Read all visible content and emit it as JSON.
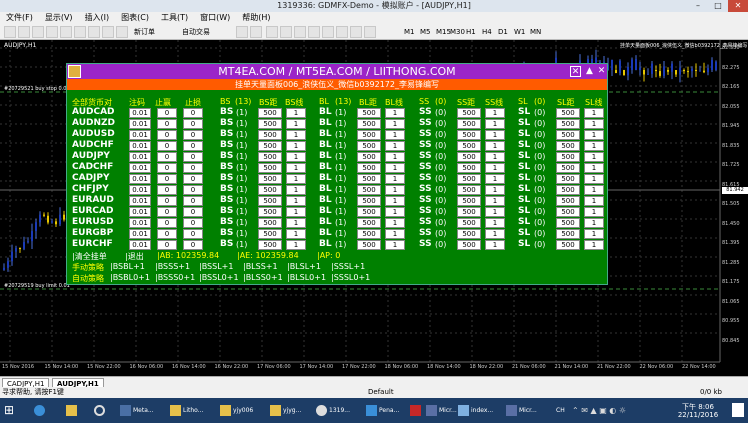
{
  "window": {
    "title": "1319336: GDMFX-Demo - 模拟账户 - [AUDJPY,H1]"
  },
  "menu": [
    "文件(F)",
    "显示(V)",
    "插入(I)",
    "图表(C)",
    "工具(T)",
    "窗口(W)",
    "帮助(H)"
  ],
  "toolbar": {
    "new_order": "新订单",
    "auto_trade": "自动交易",
    "timeframes": [
      "M1",
      "M5",
      "M15",
      "M30",
      "H1",
      "H4",
      "D1",
      "W1",
      "MN"
    ]
  },
  "chart": {
    "symbol_label": "AUDJPY,H1",
    "right_label": "挂单天量面板006_浪侠伍义_微信b0392172_李易锋编写",
    "line_label_1": "#20729521 buy stop 0.01",
    "line_label_2": "#20729519 buy limit 0.01",
    "price_labels": [
      "82.330",
      "82.275",
      "82.165",
      "82.055",
      "81.945",
      "81.835",
      "81.725",
      "81.615",
      "81.505",
      "81.450",
      "81.395",
      "81.285",
      "81.175",
      "81.065",
      "80.955",
      "80.845"
    ],
    "current_price": "81.942",
    "time_labels": [
      "15 Nov 2016",
      "15 Nov 14:00",
      "15 Nov 22:00",
      "16 Nov 06:00",
      "16 Nov 14:00",
      "16 Nov 22:00",
      "17 Nov 06:00",
      "17 Nov 14:00",
      "17 Nov 22:00",
      "18 Nov 06:00",
      "18 Nov 14:00",
      "18 Nov 22:00",
      "21 Nov 06:00",
      "21 Nov 14:00",
      "21 Nov 22:00",
      "22 Nov 06:00",
      "22 Nov 14:00"
    ]
  },
  "panel": {
    "title": "MT4EA.COM / MT5EA.COM / LIITHONG.COM",
    "subtitle": "挂单天量面板006_浪侠伍义_微信b0392172_李易锋编写",
    "headers": [
      "全部货币对",
      "注码",
      "止赢",
      "止损",
      "BS",
      "(13)",
      "BS距",
      "BS线",
      "BL",
      "(13)",
      "BL距",
      "BL线",
      "SS",
      "(0)",
      "SS距",
      "SS线",
      "SL",
      "(0)",
      "SL距",
      "SL线"
    ],
    "rows": [
      {
        "sym": "AUDCAD",
        "lot": "0.01",
        "tp": "0",
        "sl": "0"
      },
      {
        "sym": "AUDNZD",
        "lot": "0.01",
        "tp": "0",
        "sl": "0"
      },
      {
        "sym": "AUDUSD",
        "lot": "0.01",
        "tp": "0",
        "sl": "0"
      },
      {
        "sym": "AUDCHF",
        "lot": "0.01",
        "tp": "0",
        "sl": "0"
      },
      {
        "sym": "AUDJPY",
        "lot": "0.01",
        "tp": "0",
        "sl": "0"
      },
      {
        "sym": "CADCHF",
        "lot": "0.01",
        "tp": "0",
        "sl": "0"
      },
      {
        "sym": "CADJPY",
        "lot": "0.01",
        "tp": "0",
        "sl": "0"
      },
      {
        "sym": "CHFJPY",
        "lot": "0.01",
        "tp": "0",
        "sl": "0"
      },
      {
        "sym": "EURAUD",
        "lot": "0.01",
        "tp": "0",
        "sl": "0"
      },
      {
        "sym": "EURCAD",
        "lot": "0.01",
        "tp": "0",
        "sl": "0"
      },
      {
        "sym": "EURUSD",
        "lot": "0.01",
        "tp": "0",
        "sl": "0"
      },
      {
        "sym": "EURGBP",
        "lot": "0.01",
        "tp": "0",
        "sl": "0"
      },
      {
        "sym": "EURCHF",
        "lot": "0.01",
        "tp": "0",
        "sl": "0"
      }
    ],
    "order_cols": {
      "bs": "BS",
      "bl": "BL",
      "ss": "SS",
      "sl": "SL",
      "bs_count": "(1)",
      "ss_count": "(0)",
      "dist": "500",
      "line": "1"
    },
    "footer": {
      "clear_all": "|清全挂单",
      "exit": "|退出",
      "ab1": "|AB: 102359.84",
      "ae": "|AE: 102359.84",
      "ap": "|AP: 0",
      "manual_label": "手动策略",
      "manual_items": [
        "|BSBL+1",
        "|BSSS+1",
        "|BSSL+1",
        "|BLSS+1",
        "|BLSL+1",
        "|SSSL+1"
      ],
      "auto_label": "自动策略",
      "auto_items": [
        "|BSBL0+1",
        "|BSSS0+1",
        "|BSSL0+1",
        "|BLSS0+1",
        "|BLSL0+1",
        "|SSSL0+1"
      ]
    }
  },
  "tabs": [
    "CADJPY,H1",
    "AUDJPY,H1"
  ],
  "status": {
    "help": "寻求帮助, 请按F1键",
    "profile": "Default",
    "conn": "0/0 kb"
  },
  "taskbar": {
    "items": [
      "Meta...",
      "Litho...",
      "yjy006",
      "yjyg...",
      "1319...",
      "Pena...",
      "",
      "Micr...",
      "index...",
      "Micr..."
    ],
    "ime": "CH",
    "time": "下午 8:06",
    "date": "22/11/2016"
  }
}
